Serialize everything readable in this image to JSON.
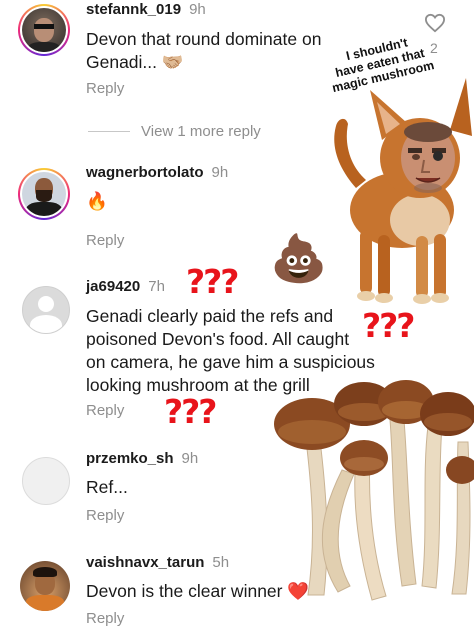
{
  "comments": [
    {
      "username": "stefannk_019",
      "time": "9h",
      "text_lines": [
        "Devon that round dominate on",
        "Genadi... 🤝🏼"
      ],
      "reply": "Reply"
    },
    {
      "username": "wagnerbortolato",
      "time": "9h",
      "text_lines": [
        "🔥"
      ],
      "reply": "Reply"
    },
    {
      "username": "ja69420",
      "time": "7h",
      "text_lines": [
        "Genadi clearly paid the refs and",
        "poisoned Devon's food. All caught",
        "on camera, he gave him a suspicious",
        "looking mushroom at the grill"
      ],
      "reply": "Reply"
    },
    {
      "username": "przemko_sh",
      "time": "9h",
      "text_lines": [
        "Ref..."
      ],
      "reply": "Reply"
    },
    {
      "username": "vaishnavx_tarun",
      "time": "5h",
      "text_lines": [
        "Devon is the clear winner ❤️"
      ],
      "reply": "Reply"
    }
  ],
  "view_more_replies": "View 1 more reply",
  "like_count": "2",
  "overlay": {
    "caption_lines": [
      "I shouldn't",
      "have eaten that",
      "magic mushroom"
    ],
    "question_marks": "???",
    "poop_emoji": "💩"
  },
  "colors": {
    "accent_red": "#e8141b",
    "meta_gray": "#8e8e8e",
    "dog_fur": "#c7742f",
    "mushroom_cap": "#8b4a22"
  }
}
